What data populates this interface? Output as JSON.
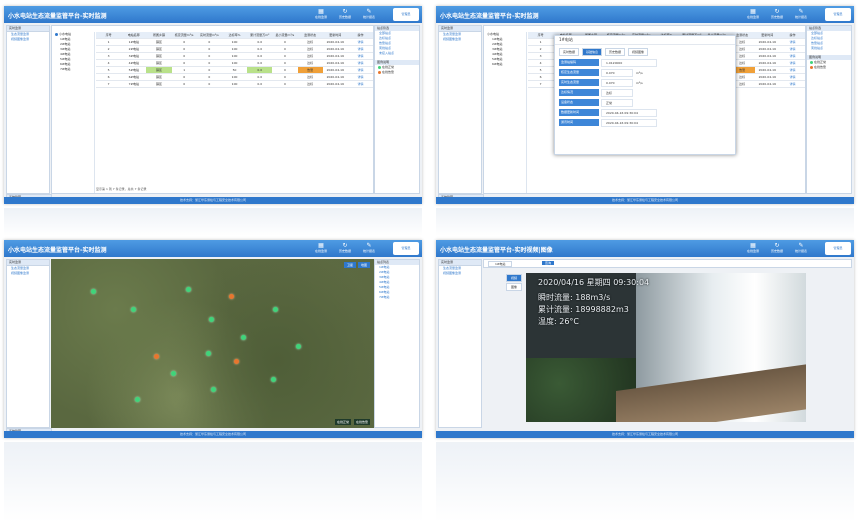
{
  "app": {
    "title": "小水电站生态流量监管平台-实时监测",
    "title_video": "小水电站生态流量监管平台-实时视频|图像",
    "nav": [
      {
        "icon": "chart-icon",
        "label": "在线监测"
      },
      {
        "icon": "refresh-icon",
        "label": "历史数据"
      },
      {
        "icon": "edit-icon",
        "label": "统计报表"
      },
      {
        "icon": "bell-icon",
        "label": "告警管理"
      }
    ],
    "user": "管理员",
    "footer": "技术支持：浙江华东测绘与工程安全技术有限公司"
  },
  "sidebar": {
    "header": "实时监测",
    "items": [
      "生态流量监测",
      "视频图像监测",
      "站点信息"
    ],
    "bottom": "系统管理"
  },
  "tree": {
    "header": "站点列表",
    "root": "小水电站",
    "stations": [
      "1#电站",
      "2#电站",
      "3#电站",
      "4#电站",
      "5#电站",
      "6#电站",
      "7#电站"
    ]
  },
  "table": {
    "columns": [
      "序号",
      "电站名称",
      "所属乡镇",
      "核定流量m³/s",
      "实时流量m³/s",
      "达标率%",
      "累计流量万m³",
      "最小流量m³/s",
      "监测状态",
      "更新时间",
      "操作"
    ],
    "rows": [
      [
        "1",
        "1#电站",
        "镇区",
        "0",
        "0",
        "100",
        "0.0",
        "0",
        "达标",
        "2020-04-16",
        "详情"
      ],
      [
        "2",
        "2#电站",
        "镇区",
        "0",
        "0",
        "100",
        "0.0",
        "0",
        "达标",
        "2020-04-16",
        "详情"
      ],
      [
        "3",
        "3#电站",
        "镇区",
        "0",
        "0",
        "100",
        "0.0",
        "0",
        "达标",
        "2020-04-16",
        "详情"
      ],
      [
        "4",
        "4#电站",
        "镇区",
        "0",
        "0",
        "100",
        "0.0",
        "0",
        "达标",
        "2020-04-16",
        "详情"
      ],
      [
        "5",
        "5#电站",
        "镇区",
        "1",
        "0",
        "50",
        "0.0",
        "0",
        "告警",
        "2020-04-16",
        "详情"
      ],
      [
        "6",
        "6#电站",
        "镇区",
        "0",
        "0",
        "100",
        "0.0",
        "0",
        "达标",
        "2020-04-16",
        "详情"
      ],
      [
        "7",
        "7#电站",
        "镇区",
        "0",
        "0",
        "100",
        "0.0",
        "0",
        "达标",
        "2020-04-16",
        "详情"
      ]
    ],
    "pager": "显示第 1 到 7 条记录，总共 7 条记录"
  },
  "right_panel": {
    "header": "站点筛选",
    "items": [
      "全部站点",
      "达标站点",
      "告警站点",
      "离线站点",
      "未接入站点"
    ],
    "legend_header": "图例说明",
    "legend": [
      {
        "label": "在线正常",
        "color": "#3fd47a"
      },
      {
        "label": "在线告警",
        "color": "#e8762e"
      },
      {
        "label": "离线",
        "color": "#9aa4ae"
      }
    ]
  },
  "modal": {
    "title": "1#电站",
    "tabs": [
      "实时数据",
      "基础信息",
      "历史数据",
      "视频图像"
    ],
    "fields": [
      {
        "label": "监测站编码",
        "value": "1.0120000"
      },
      {
        "label": "核定生态流量",
        "value": "0.070",
        "unit": "m³/s"
      },
      {
        "label": "实时生态流量",
        "value": "0.070",
        "unit": "m³/s"
      },
      {
        "label": "达标情况",
        "value": "达标"
      },
      {
        "label": "设备状态",
        "value": "正常"
      },
      {
        "label": "数据更新时间",
        "value": "2020-04-16 09:30:04"
      },
      {
        "label": "通讯时间",
        "value": "2020-04-16 09:30:04"
      }
    ]
  },
  "map": {
    "buttons": [
      "卫星",
      "地图"
    ],
    "legend": [
      "在线正常",
      "在线告警"
    ]
  },
  "video": {
    "osd_datetime": "2020/04/16 星期四 09:30:04",
    "osd_flow": "瞬时流量: 188m3/s",
    "osd_total": "累计流量: 18998882m3",
    "osd_temp": "温度: 26°C",
    "buttons": [
      "视频",
      "图像"
    ],
    "station_select": "1#电站",
    "query": "查询"
  }
}
